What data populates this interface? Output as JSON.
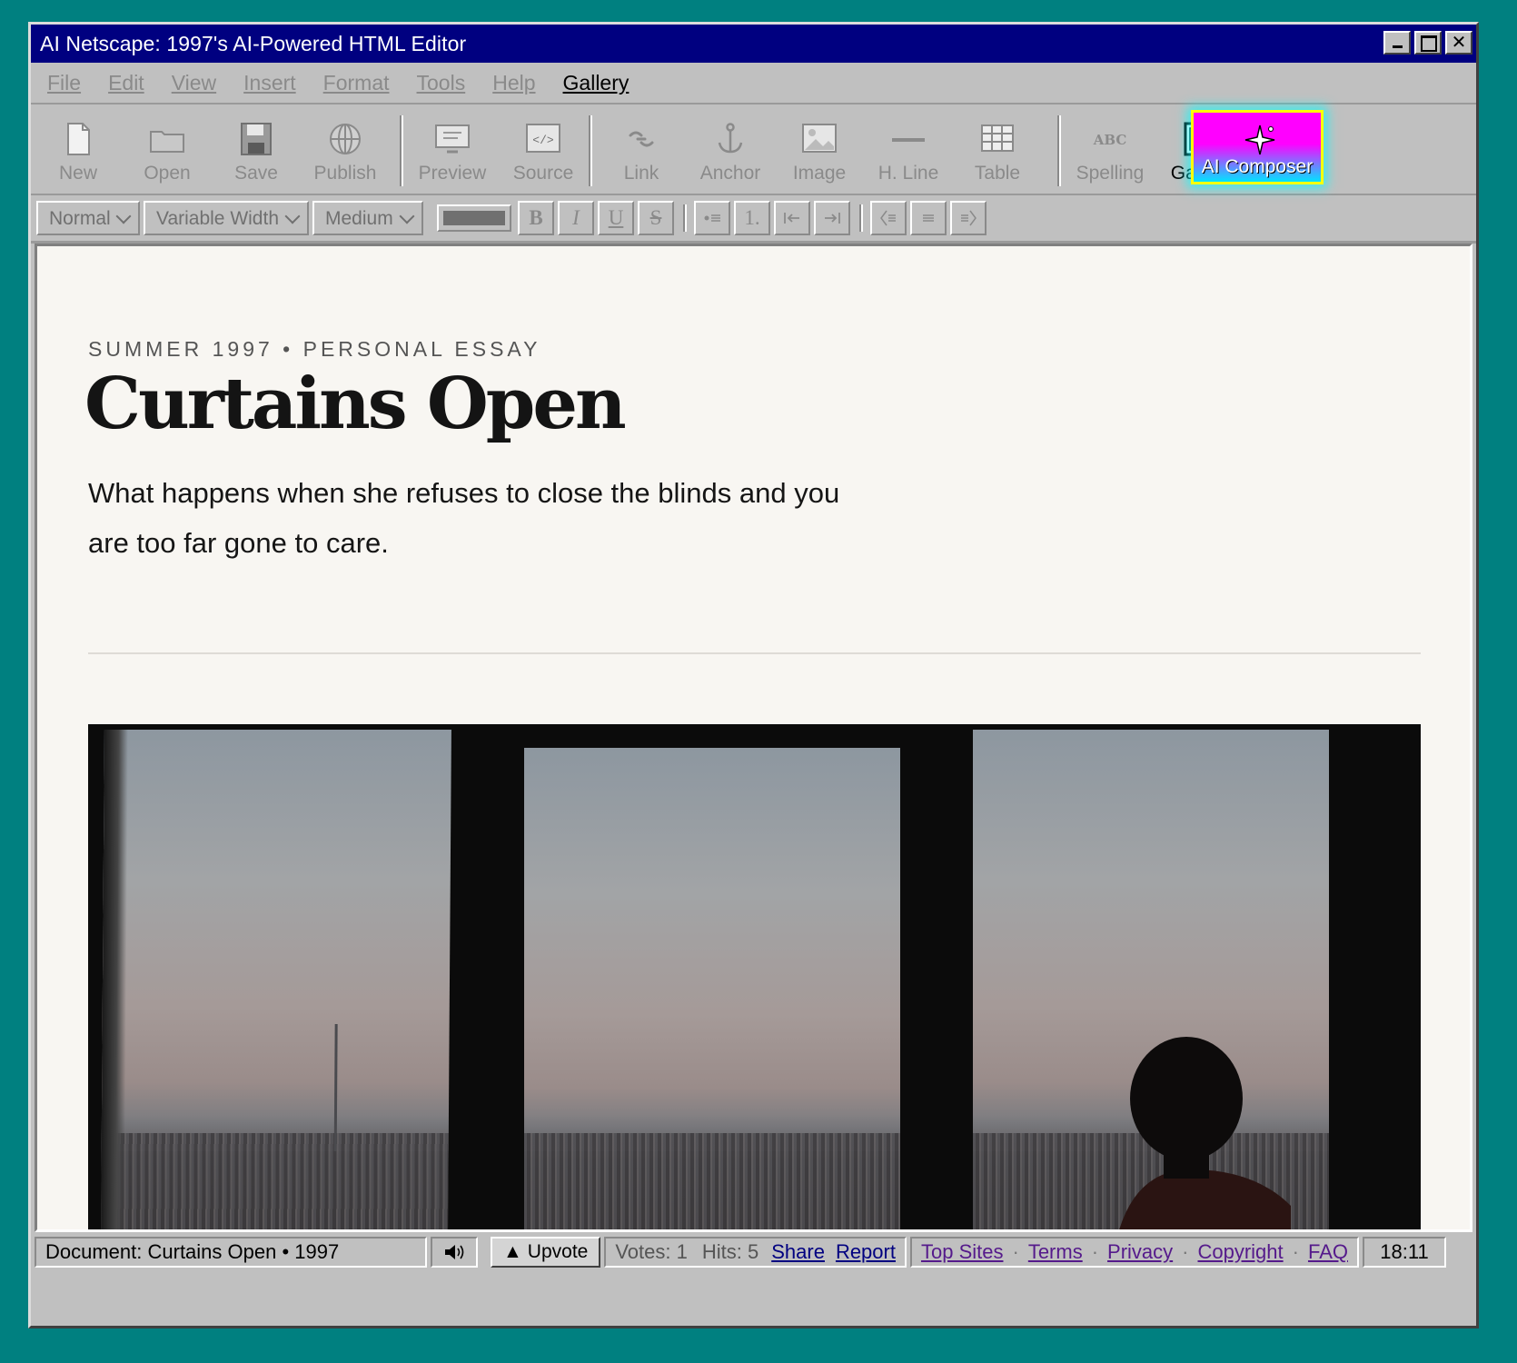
{
  "window": {
    "title": "AI Netscape: 1997's AI-Powered HTML Editor"
  },
  "menu": [
    {
      "label": "File"
    },
    {
      "label": "Edit"
    },
    {
      "label": "View"
    },
    {
      "label": "Insert"
    },
    {
      "label": "Format"
    },
    {
      "label": "Tools"
    },
    {
      "label": "Help"
    },
    {
      "label": "Gallery"
    }
  ],
  "toolbar": {
    "new": "New",
    "open": "Open",
    "save": "Save",
    "publish": "Publish",
    "preview": "Preview",
    "source": "Source",
    "source_glyph": "</>",
    "link": "Link",
    "anchor": "Anchor",
    "image": "Image",
    "hline": "H. Line",
    "table": "Table",
    "spelling": "Spelling",
    "spelling_glyph": "ABC",
    "gallery": "Gallery",
    "ai_composer": "AI Composer"
  },
  "format": {
    "paragraph": "Normal",
    "font": "Variable Width",
    "size": "Medium",
    "color": "#707070",
    "bold": "B",
    "italic": "I",
    "underline": "U",
    "strike": "S",
    "ordered": "1."
  },
  "article": {
    "kicker": "SUMMER 1997 • PERSONAL ESSAY",
    "headline": "Curtains Open",
    "dek": "What happens when she refuses to close the blinds and you are too far gone to care."
  },
  "status": {
    "document": "Document: Curtains Open • 1997",
    "sound_icon": "speaker-icon",
    "upvote": "Upvote",
    "votes": "Votes: 1",
    "hits": "Hits: 5",
    "share": "Share",
    "report": "Report",
    "footer_links": [
      "Top Sites",
      "Terms",
      "Privacy",
      "Copyright",
      "FAQ"
    ],
    "clock": "18:11"
  },
  "colors": {
    "desktop": "#008080",
    "titlebar": "#000080",
    "ai_gradient_top": "#ff00ff",
    "ai_gradient_bottom": "#00e5ff",
    "ai_border": "#ffff00"
  }
}
